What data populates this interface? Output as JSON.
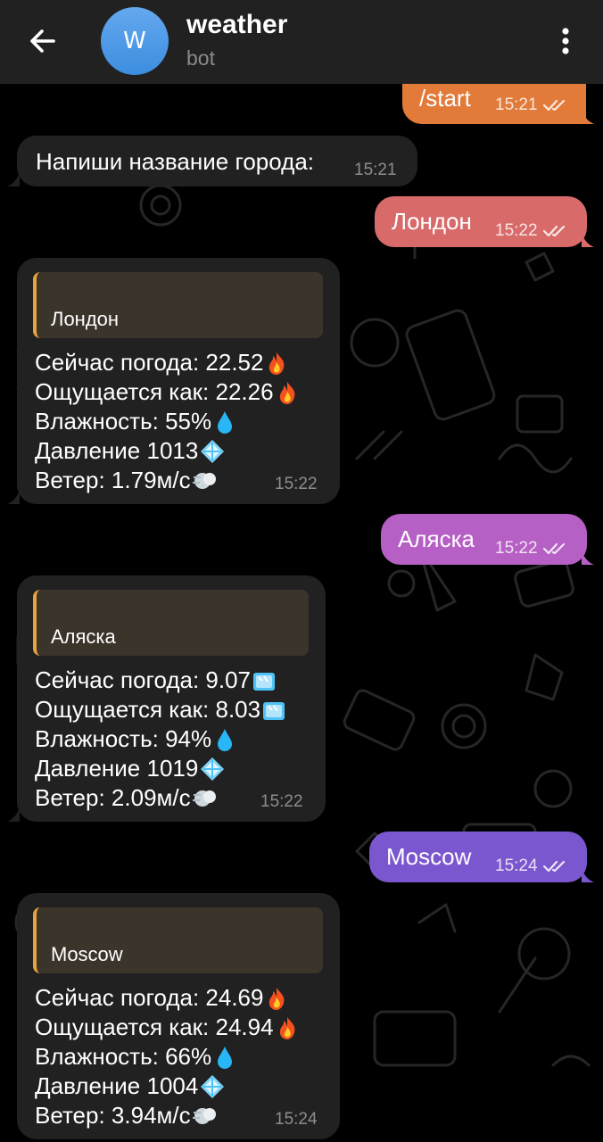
{
  "header": {
    "title": "weather",
    "subtitle": "bot",
    "avatar_letter": "W"
  },
  "icons": {
    "back": "arrow-left-icon",
    "menu": "more-vertical-icon",
    "read": "double-check-icon",
    "fire": "fire-emoji",
    "ice": "ice-cube-emoji",
    "drop": "droplet-emoji",
    "snow": "snowflake-emoji",
    "wind": "wind-face-emoji"
  },
  "colors": {
    "header_bg": "#212121",
    "incoming_bubble": "#212121",
    "quote_border": "#e7a33e",
    "outgoing_1": "#e27a3a",
    "outgoing_2": "#d86a6a",
    "outgoing_3": "#b65fc4",
    "outgoing_4": "#7b57cf"
  },
  "messages": [
    {
      "type": "out",
      "text": "/start",
      "time": "15:21"
    },
    {
      "type": "in",
      "text": "Напиши название города:",
      "time": "15:21"
    },
    {
      "type": "out",
      "text": "Лондон",
      "time": "15:22"
    },
    {
      "type": "weather",
      "city": "Лондон",
      "lines": [
        "Сейчас погода: 22.52",
        "Ощущается как: 22.26",
        "Влажность: 55%",
        "Давление 1013",
        "Ветер: 1.79м/с"
      ],
      "time": "15:22"
    },
    {
      "type": "out",
      "text": "Аляска",
      "time": "15:22"
    },
    {
      "type": "weather",
      "city": "Аляска",
      "lines": [
        "Сейчас погода: 9.07",
        "Ощущается как: 8.03",
        "Влажность: 94%",
        "Давление 1019",
        "Ветер: 2.09м/с"
      ],
      "time": "15:22"
    },
    {
      "type": "out",
      "text": "Moscow",
      "time": "15:24"
    },
    {
      "type": "weather",
      "city": "Moscow",
      "lines": [
        "Сейчас погода: 24.69",
        "Ощущается как: 24.94",
        "Влажность: 66%",
        "Давление 1004",
        "Ветер: 3.94м/с"
      ],
      "time": "15:24"
    }
  ]
}
